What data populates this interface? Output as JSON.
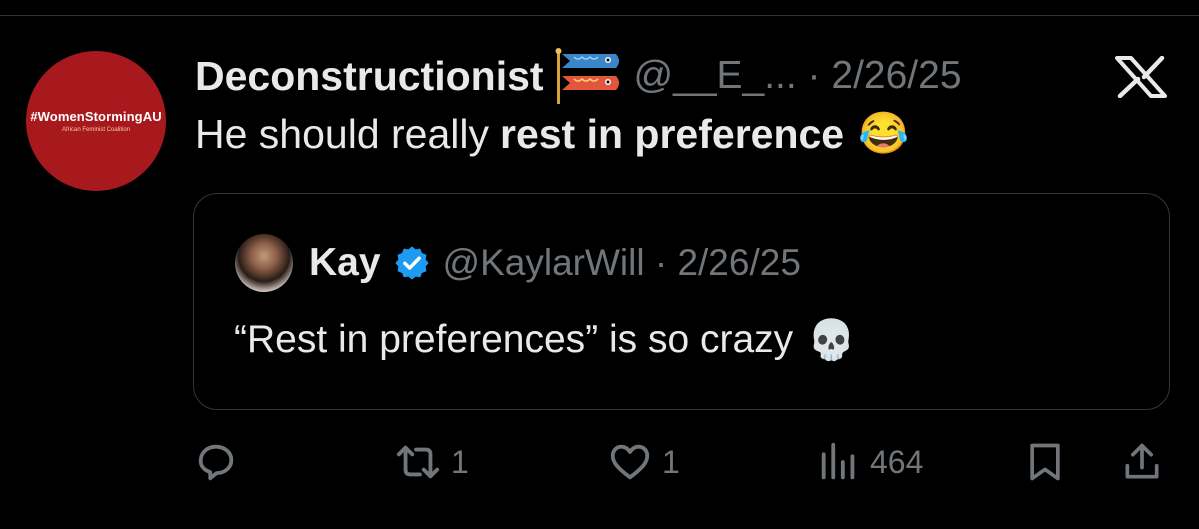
{
  "post": {
    "avatar_text": "#WomenStormingAU",
    "avatar_subtext": "African Feminist Coalition",
    "author_name": "Deconstructionist",
    "author_flag_icon": "koinobori-flag-icon",
    "handle_date": "@__E_... · 2/26/25",
    "text_plain": "He should really",
    "text_bold": "rest in preference",
    "text_emoji": "😂"
  },
  "quoted_post": {
    "author_name": "Kay",
    "verified_icon": "verified-badge-icon",
    "handle_date": "@KaylarWill · 2/26/25",
    "text": "“Rest in preferences” is so crazy",
    "text_emoji": "💀"
  },
  "actions": {
    "reply_count": "",
    "repost_count": "1",
    "like_count": "1",
    "views_count": "464"
  },
  "colors": {
    "background": "#000000",
    "primary_text": "#e7e9ea",
    "secondary_text": "#71767b",
    "verified_blue": "#1d9bf0",
    "avatar_red": "#a8191d"
  }
}
